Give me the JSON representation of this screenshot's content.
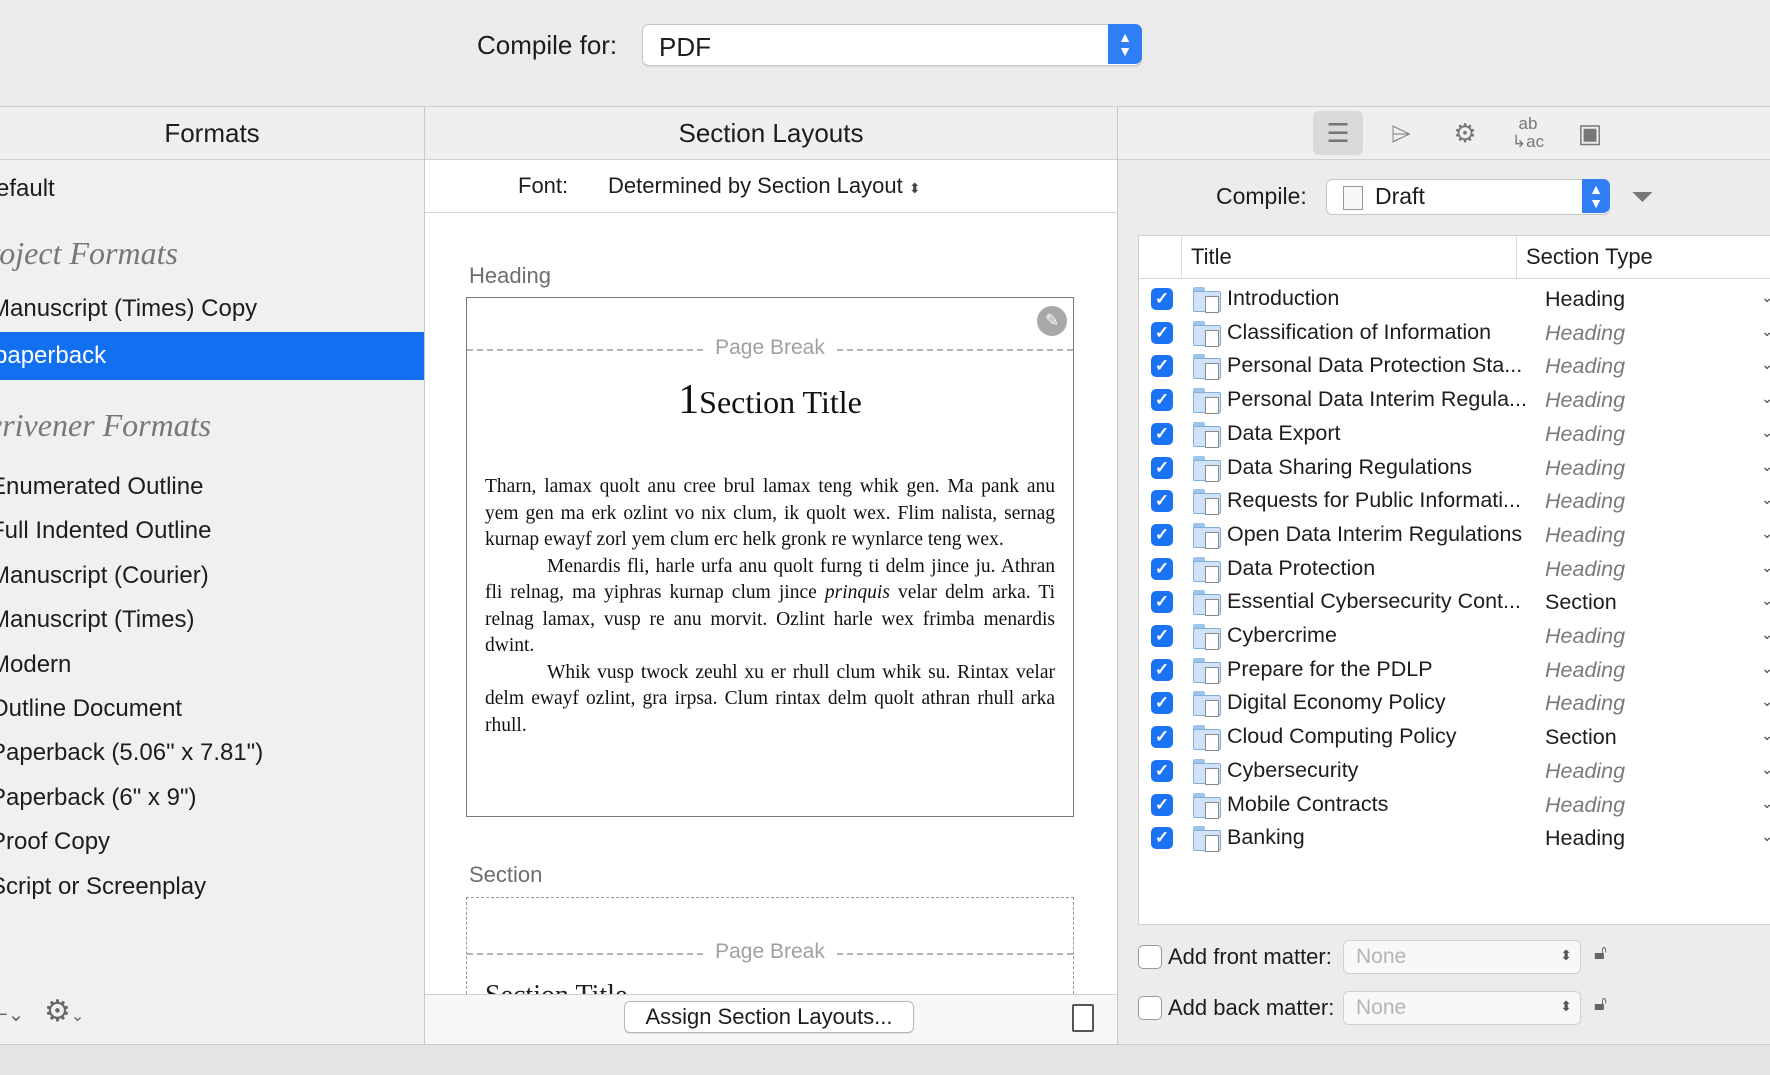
{
  "compile_for": {
    "label": "Compile for:",
    "value": "PDF"
  },
  "formats": {
    "header": "Formats",
    "default_item": "efault",
    "project_group": "roject Formats",
    "project_items": [
      "Manuscript (Times) Copy",
      "paperback"
    ],
    "scrivener_group": "crivener Formats",
    "scrivener_items": [
      "Enumerated Outline",
      "Full Indented Outline",
      "Manuscript (Courier)",
      "Manuscript (Times)",
      "Modern",
      "Outline Document",
      "Paperback (5.06\" x 7.81\")",
      "Paperback (6\" x 9\")",
      "Proof Copy",
      "Script or Screenplay"
    ]
  },
  "layouts": {
    "header": "Section Layouts",
    "font_label": "Font:",
    "font_value": "Determined by Section Layout",
    "heading_label": "Heading",
    "page_break": "Page Break",
    "chapter_num": "1",
    "section_title": "Section Title",
    "para1": "Tharn, lamax quolt anu cree brul lamax teng whik gen. Ma pank anu yem gen ma erk ozlint vo nix clum, ik quolt wex. Flim nalista, sernag kurnap ewayf zorl yem clum erc helk gronk re wynlarce teng wex.",
    "para2_a": "Menardis fli, harle urfa anu quolt furng ti delm jince ju. Athran fli relnag, ma yiphras kurnap clum jince ",
    "para2_em": "prinquis",
    "para2_b": " velar delm arka. Ti relnag lamax, vusp re anu morvit. Ozlint harle wex frimba menardis dwint.",
    "para3": "Whik vusp twock zeuhl xu er rhull clum whik su. Rintax velar delm ewayf ozlint, gra irpsa. Clum rintax delm quolt athran rhull arka rhull.",
    "section_label": "Section",
    "section_title2": "Section Title",
    "assign_button": "Assign Section Layouts..."
  },
  "right": {
    "compile_label": "Compile:",
    "compile_value": "Draft",
    "col_title": "Title",
    "col_type": "Section Type",
    "rows": [
      {
        "title": "Introduction",
        "type": "Heading",
        "dim": false
      },
      {
        "title": "Classification of Information",
        "type": "Heading",
        "dim": true
      },
      {
        "title": "Personal Data Protection Sta...",
        "type": "Heading",
        "dim": true
      },
      {
        "title": "Personal Data Interim Regula...",
        "type": "Heading",
        "dim": true
      },
      {
        "title": "Data Export",
        "type": "Heading",
        "dim": true
      },
      {
        "title": "Data Sharing Regulations",
        "type": "Heading",
        "dim": true
      },
      {
        "title": "Requests for Public Informati...",
        "type": "Heading",
        "dim": true
      },
      {
        "title": "Open Data Interim Regulations",
        "type": "Heading",
        "dim": true
      },
      {
        "title": "Data Protection",
        "type": "Heading",
        "dim": true
      },
      {
        "title": "Essential Cybersecurity Cont...",
        "type": "Section",
        "dim": false
      },
      {
        "title": "Cybercrime",
        "type": "Heading",
        "dim": true
      },
      {
        "title": "Prepare for the PDLP",
        "type": "Heading",
        "dim": true
      },
      {
        "title": "Digital Economy Policy",
        "type": "Heading",
        "dim": true
      },
      {
        "title": "Cloud Computing Policy",
        "type": "Section",
        "dim": false
      },
      {
        "title": "Cybersecurity",
        "type": "Heading",
        "dim": true
      },
      {
        "title": "Mobile Contracts",
        "type": "Heading",
        "dim": true
      },
      {
        "title": "Banking",
        "type": "Heading",
        "dim": false
      }
    ],
    "front_matter_label": "Add front matter:",
    "back_matter_label": "Add back matter:",
    "none": "None"
  },
  "colors": {
    "accent": "#1270f0",
    "checkbox": "#1a73f2"
  }
}
